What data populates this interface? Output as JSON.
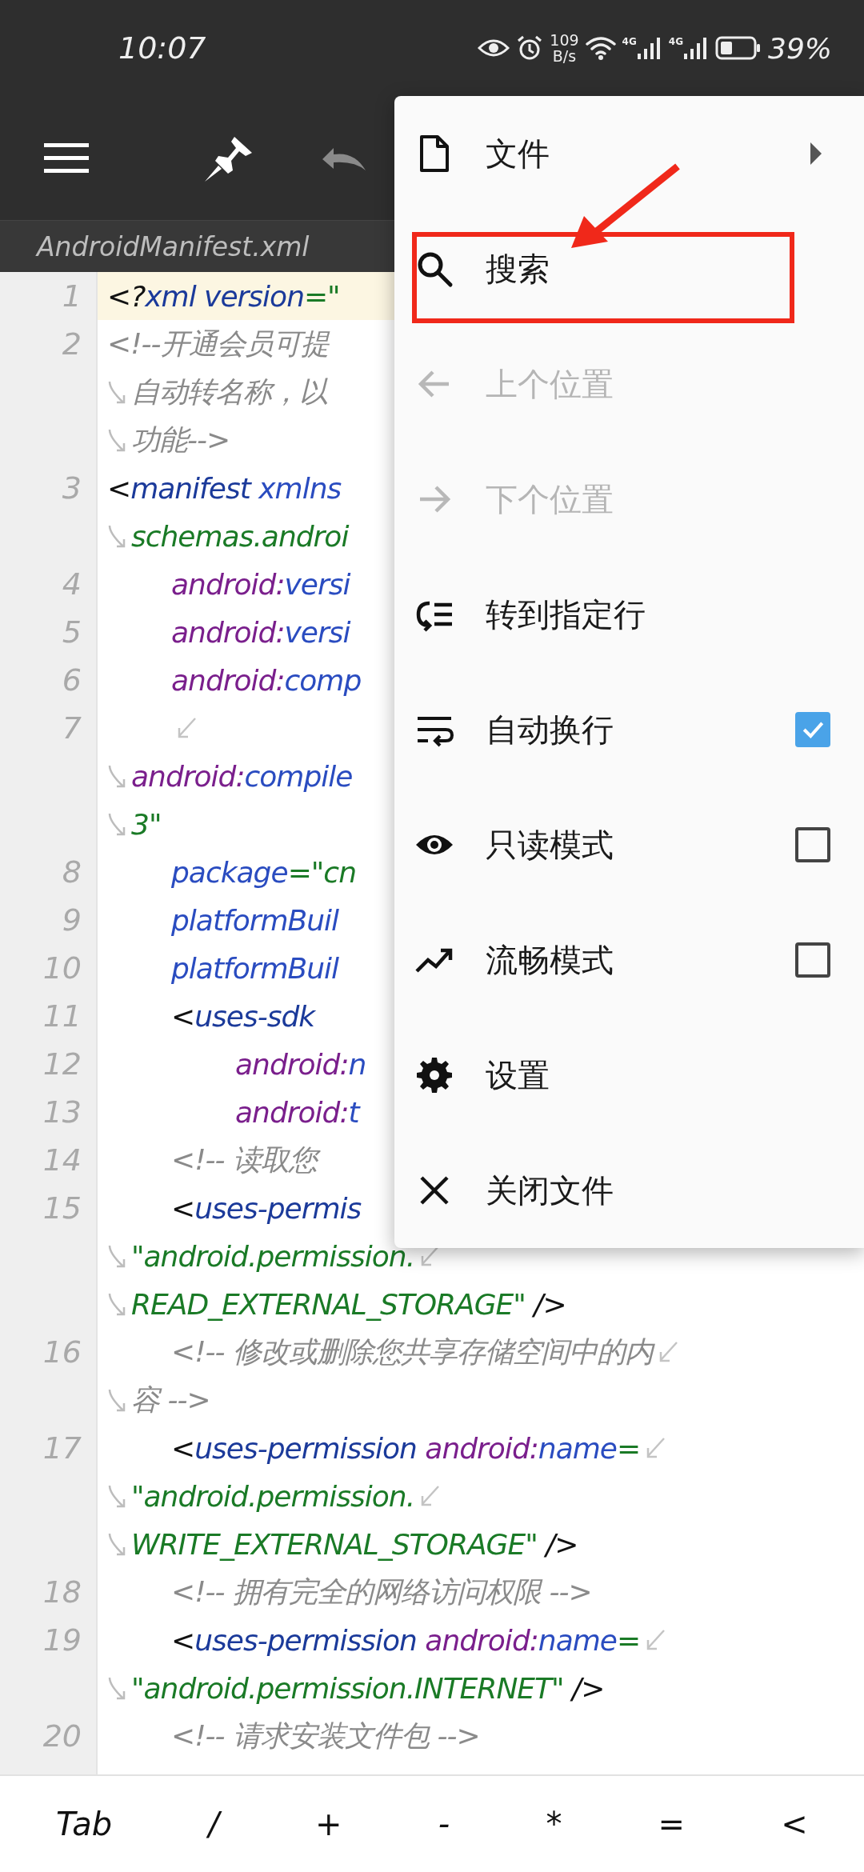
{
  "status_bar": {
    "time": "10:07",
    "net_speed": "109",
    "net_unit": "B/s",
    "signal_labels": [
      "4G",
      "4G"
    ],
    "battery": "39%"
  },
  "toolbar": {
    "undo": {
      "disabled": true
    },
    "file_tab": "AndroidManifest.xml"
  },
  "code": [
    {
      "number": "1",
      "continued": false,
      "wraps": false,
      "highlighted": true,
      "tokens": [
        {
          "kind": "punct",
          "text": "<?"
        },
        {
          "kind": "tag",
          "text": "xml version"
        },
        {
          "kind": "value",
          "text": "=\""
        }
      ]
    },
    {
      "number": "2",
      "continued": false,
      "wraps": false,
      "highlighted": false,
      "tokens": [
        {
          "kind": "comment",
          "text": "<!--开通会员可提"
        }
      ]
    },
    {
      "continued": true,
      "wraps": false,
      "highlighted": false,
      "tokens": [
        {
          "kind": "comment",
          "text": "自动转名称，以"
        }
      ]
    },
    {
      "continued": true,
      "wraps": false,
      "highlighted": false,
      "tokens": [
        {
          "kind": "comment",
          "text": "功能-->"
        }
      ]
    },
    {
      "number": "3",
      "continued": false,
      "wraps": false,
      "highlighted": false,
      "tokens": [
        {
          "kind": "punct",
          "text": "<"
        },
        {
          "kind": "tag",
          "text": "manifest"
        },
        {
          "kind": "attr",
          "text": " xmlns"
        }
      ]
    },
    {
      "continued": true,
      "wraps": false,
      "highlighted": false,
      "tokens": [
        {
          "kind": "value",
          "text": "schemas.androi"
        }
      ]
    },
    {
      "number": "4",
      "continued": false,
      "wraps": false,
      "highlighted": false,
      "tokens": [
        {
          "kind": "ns",
          "text": "\tandroid:"
        },
        {
          "kind": "attr",
          "text": "versi"
        }
      ]
    },
    {
      "number": "5",
      "continued": false,
      "wraps": false,
      "highlighted": false,
      "tokens": [
        {
          "kind": "ns",
          "text": "\tandroid:"
        },
        {
          "kind": "attr",
          "text": "versi"
        }
      ]
    },
    {
      "number": "6",
      "continued": false,
      "wraps": false,
      "highlighted": false,
      "tokens": [
        {
          "kind": "ns",
          "text": "\tandroid:"
        },
        {
          "kind": "attr",
          "text": "comp"
        }
      ]
    },
    {
      "number": "7",
      "continued": false,
      "wraps": true,
      "highlighted": false
    },
    {
      "continued": true,
      "wraps": false,
      "highlighted": false,
      "tokens": [
        {
          "kind": "ns",
          "text": "android:"
        },
        {
          "kind": "attr",
          "text": "compile"
        }
      ]
    },
    {
      "continued": true,
      "wraps": false,
      "highlighted": false,
      "tokens": [
        {
          "kind": "value",
          "text": "3\""
        }
      ]
    },
    {
      "number": "8",
      "continued": false,
      "wraps": false,
      "highlighted": false,
      "tokens": [
        {
          "kind": "attr",
          "text": "\tpackage"
        },
        {
          "kind": "value",
          "text": "=\"cn"
        }
      ]
    },
    {
      "number": "9",
      "continued": false,
      "wraps": false,
      "highlighted": false,
      "tokens": [
        {
          "kind": "attr",
          "text": "\tplatformBuil"
        }
      ]
    },
    {
      "number": "10",
      "continued": false,
      "wraps": false,
      "highlighted": false,
      "tokens": [
        {
          "kind": "attr",
          "text": "\tplatformBuil"
        }
      ]
    },
    {
      "number": "11",
      "continued": false,
      "wraps": false,
      "highlighted": false,
      "tokens": [
        {
          "kind": "punct",
          "text": "\t<"
        },
        {
          "kind": "tag",
          "text": "uses-sdk"
        }
      ]
    },
    {
      "number": "12",
      "continued": false,
      "wraps": false,
      "highlighted": false,
      "tokens": [
        {
          "kind": "ns",
          "text": "\t\tandroid:"
        },
        {
          "kind": "attr",
          "text": "n"
        }
      ]
    },
    {
      "number": "13",
      "continued": false,
      "wraps": false,
      "highlighted": false,
      "tokens": [
        {
          "kind": "ns",
          "text": "\t\tandroid:"
        },
        {
          "kind": "attr",
          "text": "t"
        }
      ]
    },
    {
      "number": "14",
      "continued": false,
      "wraps": false,
      "highlighted": false,
      "tokens": [
        {
          "kind": "comment",
          "text": "\t<!-- 读取您"
        }
      ]
    },
    {
      "number": "15",
      "continued": false,
      "wraps": false,
      "highlighted": false,
      "tokens": [
        {
          "kind": "punct",
          "text": "\t<"
        },
        {
          "kind": "tag",
          "text": "uses-permis"
        }
      ]
    },
    {
      "continued": true,
      "wraps": true,
      "highlighted": false,
      "tokens": [
        {
          "kind": "value",
          "text": "\"android.permission."
        }
      ]
    },
    {
      "continued": true,
      "wraps": false,
      "highlighted": false,
      "tokens": [
        {
          "kind": "value",
          "text": "READ_EXTERNAL_STORAGE\""
        },
        {
          "kind": "punct",
          "text": " />"
        }
      ]
    },
    {
      "number": "16",
      "continued": false,
      "wraps": true,
      "highlighted": false,
      "tokens": [
        {
          "kind": "comment",
          "text": "\t<!-- 修改或删除您共享存储空间中的内"
        }
      ]
    },
    {
      "continued": true,
      "wraps": false,
      "highlighted": false,
      "tokens": [
        {
          "kind": "comment",
          "text": "容 -->"
        }
      ]
    },
    {
      "number": "17",
      "continued": false,
      "wraps": true,
      "highlighted": false,
      "tokens": [
        {
          "kind": "punct",
          "text": "\t<"
        },
        {
          "kind": "tag",
          "text": "uses-permission"
        },
        {
          "kind": "ns",
          "text": " android:"
        },
        {
          "kind": "attr",
          "text": "name"
        },
        {
          "kind": "value",
          "text": "="
        }
      ]
    },
    {
      "continued": true,
      "wraps": true,
      "highlighted": false,
      "tokens": [
        {
          "kind": "value",
          "text": "\"android.permission."
        }
      ]
    },
    {
      "continued": true,
      "wraps": false,
      "highlighted": false,
      "tokens": [
        {
          "kind": "value",
          "text": "WRITE_EXTERNAL_STORAGE\""
        },
        {
          "kind": "punct",
          "text": " />"
        }
      ]
    },
    {
      "number": "18",
      "continued": false,
      "wraps": false,
      "highlighted": false,
      "tokens": [
        {
          "kind": "comment",
          "text": "\t<!-- 拥有完全的网络访问权限 -->"
        }
      ]
    },
    {
      "number": "19",
      "continued": false,
      "wraps": true,
      "highlighted": false,
      "tokens": [
        {
          "kind": "punct",
          "text": "\t<"
        },
        {
          "kind": "tag",
          "text": "uses-permission"
        },
        {
          "kind": "ns",
          "text": " android:"
        },
        {
          "kind": "attr",
          "text": "name"
        },
        {
          "kind": "value",
          "text": "="
        }
      ]
    },
    {
      "continued": true,
      "wraps": false,
      "highlighted": false,
      "tokens": [
        {
          "kind": "value",
          "text": "\"android.permission.INTERNET\""
        },
        {
          "kind": "punct",
          "text": " />"
        }
      ]
    },
    {
      "number": "20",
      "continued": false,
      "wraps": false,
      "highlighted": false,
      "tokens": [
        {
          "kind": "comment",
          "text": "\t<!-- 请求安装文件包 -->"
        }
      ]
    }
  ],
  "menu": {
    "items": [
      {
        "label": "文件",
        "kind": "submenu",
        "disabled": false
      },
      {
        "label": "搜索",
        "kind": "action",
        "disabled": false
      },
      {
        "label": "上个位置",
        "kind": "action",
        "disabled": true
      },
      {
        "label": "下个位置",
        "kind": "action",
        "disabled": true
      },
      {
        "label": "转到指定行",
        "kind": "action",
        "disabled": false
      },
      {
        "label": "自动换行",
        "kind": "toggle",
        "disabled": false,
        "checked": true
      },
      {
        "label": "只读模式",
        "kind": "toggle",
        "disabled": false,
        "checked": false
      },
      {
        "label": "流畅模式",
        "kind": "toggle",
        "disabled": false,
        "checked": false
      },
      {
        "label": "设置",
        "kind": "action",
        "disabled": false
      },
      {
        "label": "关闭文件",
        "kind": "action",
        "disabled": false
      }
    ]
  },
  "keys": [
    "Tab",
    "/",
    "+",
    "-",
    "*",
    "=",
    "<"
  ]
}
